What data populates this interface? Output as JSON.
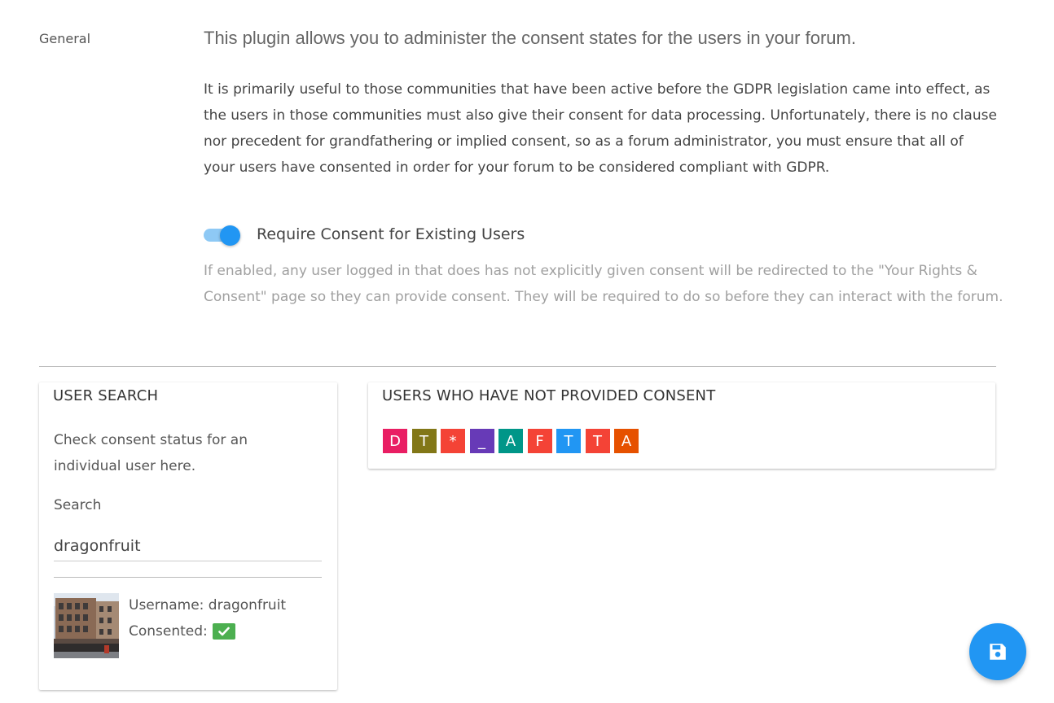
{
  "section": {
    "label": "General"
  },
  "intro": {
    "headline": "This plugin allows you to administer the consent states for the users in your forum.",
    "body": "It is primarily useful to those communities that have been active before the GDPR legislation came into effect, as the users in those communities must also give their consent for data processing. Unfortunately, there is no clause nor precedent for grandfathering or implied consent, so as a forum administrator, you must ensure that all of your users have consented in order for your forum to be considered compliant with GDPR."
  },
  "setting": {
    "toggle_label": "Require Consent for Existing Users",
    "toggle_on": true,
    "help_text": "If enabled, any user logged in that does has not explicitly given consent will be redirected to the \"Your Rights & Consent\" page so they can provide consent. They will be required to do so before they can interact with the forum."
  },
  "user_search": {
    "title": "USER SEARCH",
    "description": "Check consent status for an individual user here.",
    "search_label": "Search",
    "search_value": "dragonfruit",
    "result": {
      "username_line": "Username: dragonfruit",
      "consented_label": "Consented:",
      "consented": true
    }
  },
  "no_consent": {
    "title": "USERS WHO HAVE NOT PROVIDED CONSENT",
    "avatars": [
      {
        "letter": "D",
        "color": "#e91e63"
      },
      {
        "letter": "T",
        "color": "#827717"
      },
      {
        "letter": "*",
        "color": "#f44336"
      },
      {
        "letter": "_",
        "color": "#673ab7"
      },
      {
        "letter": "A",
        "color": "#009688"
      },
      {
        "letter": "F",
        "color": "#f44336"
      },
      {
        "letter": "T",
        "color": "#2196f3"
      },
      {
        "letter": "T",
        "color": "#f44336"
      },
      {
        "letter": "A",
        "color": "#e65100"
      }
    ]
  },
  "theme": {
    "accent": "#2196f3",
    "success": "#4caf50"
  },
  "icons": {
    "save": "floppy-disk-icon",
    "check": "check-icon"
  }
}
